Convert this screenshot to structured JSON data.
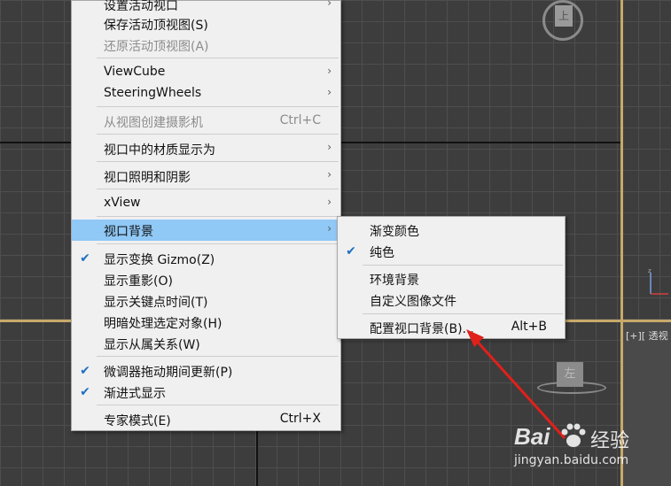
{
  "viewport": {
    "perspective_label": "[+][ 透视",
    "viewcube_top_label": "上",
    "viewcube_bottom_label": "左"
  },
  "main_menu": {
    "items": [
      {
        "label": "设置活动视口",
        "arrow": "›"
      },
      {
        "label": "保存活动顶视图(S)"
      },
      {
        "label": "还原活动顶视图(A)",
        "disabled": true
      },
      {
        "label": "ViewCube",
        "arrow": "›"
      },
      {
        "label": "SteeringWheels",
        "arrow": "›"
      },
      {
        "label": "从视图创建摄影机",
        "shortcut": "Ctrl+C",
        "disabled": true
      },
      {
        "label": "视口中的材质显示为",
        "arrow": "›"
      },
      {
        "label": "视口照明和阴影",
        "arrow": "›"
      },
      {
        "label": "xView",
        "arrow": "›"
      },
      {
        "label": "视口背景",
        "arrow": "›",
        "highlight": true
      },
      {
        "label": "显示变换 Gizmo(Z)",
        "check": "✔"
      },
      {
        "label": "显示重影(O)"
      },
      {
        "label": "显示关键点时间(T)"
      },
      {
        "label": "明暗处理选定对象(H)"
      },
      {
        "label": "显示从属关系(W)"
      },
      {
        "label": "微调器拖动期间更新(P)",
        "check": "✔"
      },
      {
        "label": "渐进式显示",
        "check": "✔"
      },
      {
        "label": "专家模式(E)",
        "shortcut": "Ctrl+X"
      }
    ]
  },
  "sub_menu": {
    "items": [
      {
        "label": "渐变颜色"
      },
      {
        "label": "纯色",
        "check": "✔"
      },
      {
        "label": "环境背景"
      },
      {
        "label": "自定义图像文件"
      },
      {
        "label": "配置视口背景(B)...",
        "shortcut": "Alt+B"
      }
    ]
  },
  "watermark": {
    "brand": "Bai",
    "brand_cn": "经验",
    "url": "jingyan.baidu.com"
  },
  "colors": {
    "highlight": "#90c8f6",
    "check": "#1f6fc4",
    "arrow_annotation": "#e0201a"
  }
}
